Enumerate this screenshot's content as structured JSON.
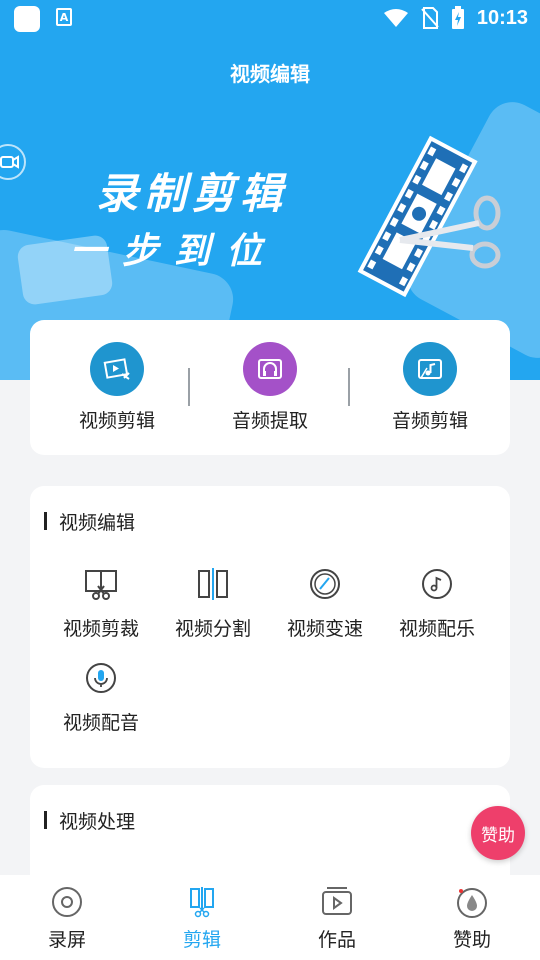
{
  "status_bar": {
    "time": "10:13",
    "notification_icon": "A"
  },
  "header": {
    "title": "视频编辑"
  },
  "banner": {
    "line1": "录制剪辑",
    "line2": "一步到位"
  },
  "quick_actions": [
    {
      "label": "视频剪辑",
      "icon": "video-edit-icon",
      "color": "#1f95cf"
    },
    {
      "label": "音频提取",
      "icon": "audio-extract-icon",
      "color": "#a451c8"
    },
    {
      "label": "音频剪辑",
      "icon": "audio-edit-icon",
      "color": "#1f95cf"
    }
  ],
  "video_edit_section": {
    "title": "视频编辑",
    "tools": [
      {
        "label": "视频剪裁",
        "icon": "crop-scissors-icon"
      },
      {
        "label": "视频分割",
        "icon": "split-icon"
      },
      {
        "label": "视频变速",
        "icon": "speed-icon"
      },
      {
        "label": "视频配乐",
        "icon": "music-note-icon"
      },
      {
        "label": "视频配音",
        "icon": "microphone-icon"
      }
    ]
  },
  "video_process_section": {
    "title": "视频处理"
  },
  "fab": {
    "label": "赞助"
  },
  "bottom_nav": [
    {
      "label": "录屏",
      "icon": "record-icon",
      "active": false
    },
    {
      "label": "剪辑",
      "icon": "cut-icon",
      "active": true
    },
    {
      "label": "作品",
      "icon": "works-icon",
      "active": false
    },
    {
      "label": "赞助",
      "icon": "sponsor-icon",
      "active": false
    }
  ],
  "colors": {
    "primary": "#23a6f0",
    "fab": "#ee3f6b",
    "background": "#f3f4f6"
  }
}
